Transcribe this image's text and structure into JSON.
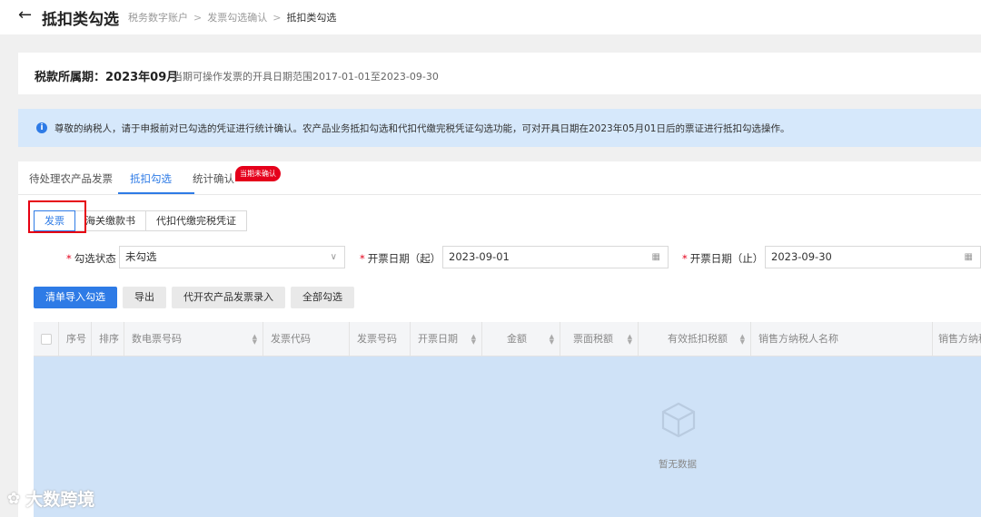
{
  "header": {
    "title": "抵扣类勾选",
    "breadcrumb": [
      "税务数字账户",
      "发票勾选确认",
      "抵扣类勾选"
    ]
  },
  "period": {
    "label": "税款所属期：2023年09月",
    "range": "当期可操作发票的开具日期范围2017-01-01至2023-09-30"
  },
  "notice": {
    "text": "尊敬的纳税人，请于申报前对已勾选的凭证进行统计确认。农产品业务抵扣勾选和代扣代缴完税凭证勾选功能，可对开具日期在2023年05月01日后的票证进行抵扣勾选操作。"
  },
  "tabs": {
    "items": [
      "待处理农产品发票",
      "抵扣勾选",
      "统计确认"
    ],
    "active": "抵扣勾选",
    "badge": "当期未确认"
  },
  "subtabs": {
    "items": [
      "发票",
      "海关缴款书",
      "代扣代缴完税凭证"
    ],
    "active": "发票"
  },
  "filters": {
    "status_label": "勾选状态",
    "status_value": "未勾选",
    "start_label": "开票日期（起）",
    "start_value": "2023-09-01",
    "end_label": "开票日期（止）",
    "end_value": "2023-09-30"
  },
  "actions": [
    "清单导入勾选",
    "导出",
    "代开农产品发票录入",
    "全部勾选"
  ],
  "table": {
    "columns": [
      "序号",
      "排序",
      "数电票号码",
      "发票代码",
      "发票号码",
      "开票日期",
      "金额",
      "票面税额",
      "有效抵扣税额",
      "销售方纳税人名称",
      "销售方纳税"
    ],
    "empty_text": "暂无数据"
  },
  "watermark": {
    "text": "大数跨境"
  },
  "colors": {
    "accent": "#2e7be6",
    "badge": "#e5001b",
    "notice_bg": "#d6e8fb",
    "highlight": "#e60012"
  }
}
